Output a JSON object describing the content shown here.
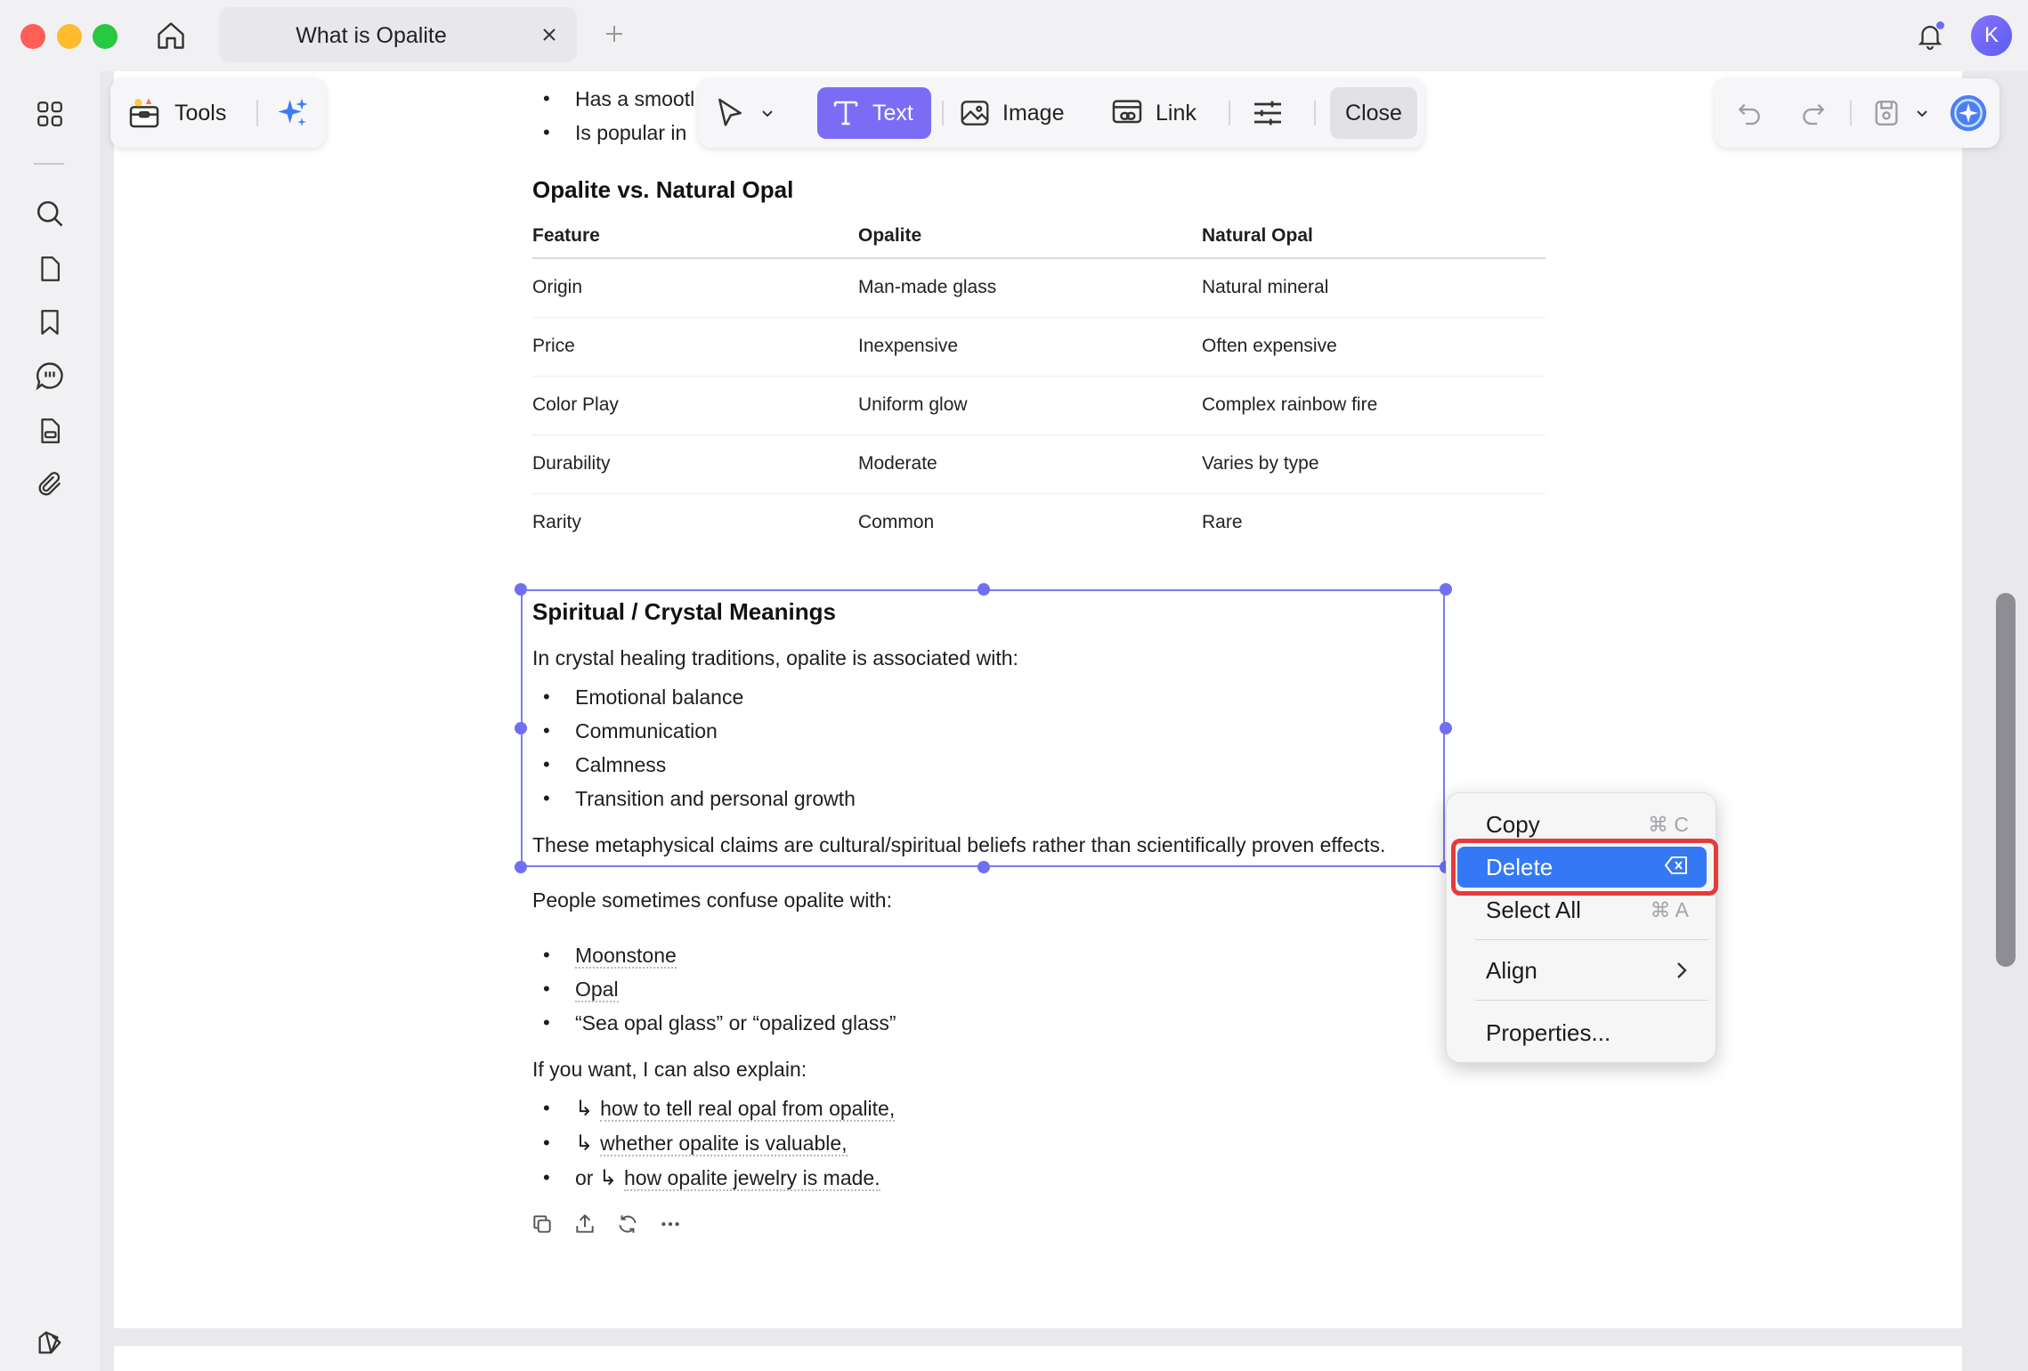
{
  "window": {
    "tab_title": "What is Opalite",
    "avatar_initial": "K"
  },
  "toolbar_left": {
    "tools_label": "Tools"
  },
  "edit_toolbar": {
    "text_label": "Text",
    "image_label": "Image",
    "link_label": "Link",
    "close_label": "Close"
  },
  "document": {
    "top_bullets": [
      "Has a smootl",
      "Is popular in"
    ],
    "comparison_heading": "Opalite vs. Natural Opal",
    "table": {
      "headers": [
        "Feature",
        "Opalite",
        "Natural Opal"
      ],
      "rows": [
        [
          "Origin",
          "Man-made glass",
          "Natural mineral"
        ],
        [
          "Price",
          "Inexpensive",
          "Often expensive"
        ],
        [
          "Color Play",
          "Uniform glow",
          "Complex rainbow fire"
        ],
        [
          "Durability",
          "Moderate",
          "Varies by type"
        ],
        [
          "Rarity",
          "Common",
          "Rare"
        ]
      ]
    },
    "spiritual_heading": "Spiritual / Crystal Meanings",
    "spiritual_intro": "In crystal healing traditions, opalite is associated with:",
    "spiritual_bullets": [
      "Emotional balance",
      "Communication",
      "Calmness",
      "Transition and personal growth"
    ],
    "spiritual_note": "These metaphysical claims are cultural/spiritual beliefs rather than scientifically proven effects.",
    "confuse_intro": "People sometimes confuse opalite with:",
    "confuse_bullets": [
      "Moonstone",
      "Opal",
      "“Sea opal glass” or “opalized glass”"
    ],
    "explain_intro": "If you want, I can also explain:",
    "explain_arrow": "↳",
    "explain_items": [
      "how to tell real opal from opalite,",
      "whether opalite is valuable,",
      "how opalite jewelry is made."
    ],
    "explain_or": "or"
  },
  "context_menu": {
    "copy": "Copy",
    "copy_shortcut": "⌘ C",
    "delete": "Delete",
    "select_all": "Select All",
    "select_all_shortcut": "⌘ A",
    "align": "Align",
    "properties": "Properties..."
  }
}
